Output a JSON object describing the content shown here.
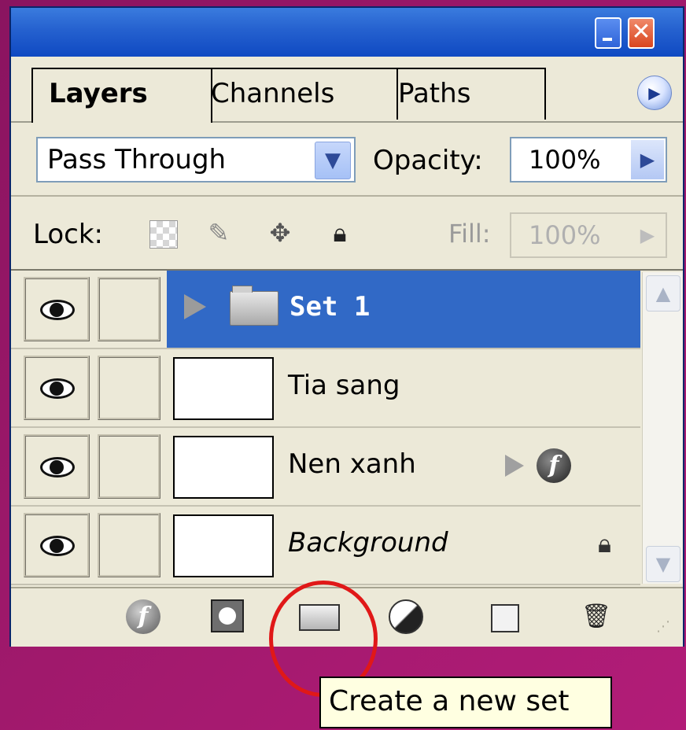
{
  "window": {
    "minimize_icon": "minimize-icon",
    "close_label": "✕"
  },
  "tabs": [
    {
      "label": "Layers",
      "active": true
    },
    {
      "label": "Channels",
      "active": false
    },
    {
      "label": "Paths",
      "active": false
    }
  ],
  "panel_menu_icon": "▶",
  "blend": {
    "mode": "Pass Through",
    "opacity_label": "Opacity:",
    "opacity_value": "100%"
  },
  "lock": {
    "label": "Lock:",
    "fill_label": "Fill:",
    "fill_value": "100%"
  },
  "layers": [
    {
      "name": "Set 1",
      "type": "set",
      "selected": true,
      "visible": true
    },
    {
      "name": "Tia sang",
      "type": "layer",
      "thumbnail": "transparent",
      "visible": true
    },
    {
      "name": "Nen xanh",
      "type": "layer",
      "thumbnail": "white",
      "has_effects": true,
      "visible": true
    },
    {
      "name": "Background",
      "type": "background",
      "thumbnail": "white",
      "locked": true,
      "visible": true
    }
  ],
  "bottom_toolbar": [
    "layer-style-icon",
    "add-mask-icon",
    "new-set-icon",
    "adjustment-layer-icon",
    "new-layer-icon",
    "trash-icon"
  ],
  "tooltip": "Create a new set",
  "colors": {
    "title_bar": "#2561cf",
    "selection": "#3169c6",
    "panel_bg": "#ece9d8",
    "highlight_circle": "#e01818"
  }
}
